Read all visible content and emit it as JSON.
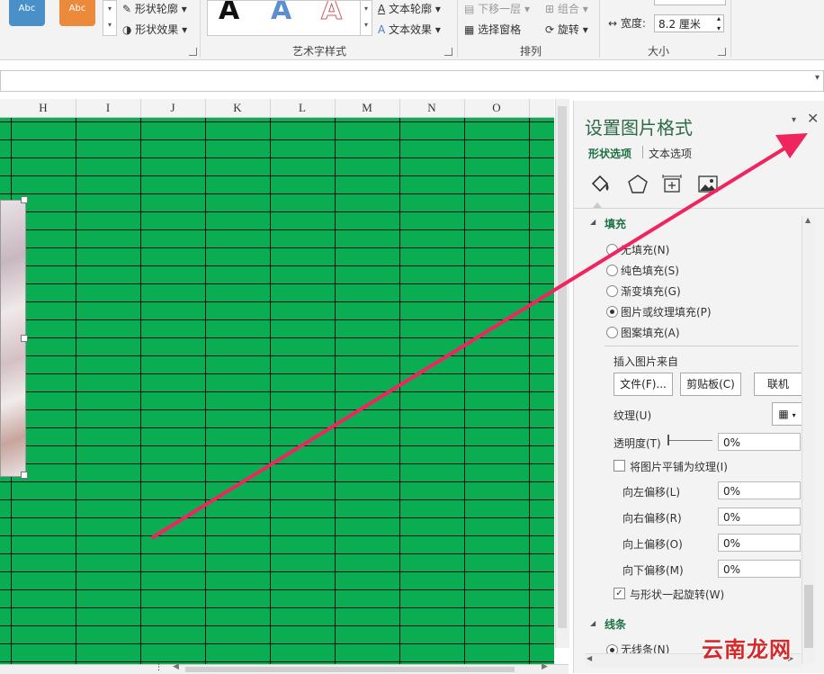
{
  "ribbon": {
    "style_thumb_1": "Abc",
    "style_thumb_2": "Abc",
    "shape_outline": "形状轮廓",
    "shape_effect": "形状效果",
    "wordart_letter": "A",
    "text_outline": "文本轮廓",
    "text_effect": "文本效果",
    "wordart_group_label": "艺术字样式",
    "send_backward": "下移一层",
    "group": "组合",
    "selection_pane": "选择窗格",
    "rotate": "旋转",
    "arrange_group_label": "排列",
    "width_label": "宽度:",
    "width_value": "8.2 厘米",
    "size_group_label": "大小"
  },
  "sheet": {
    "columns": [
      "H",
      "I",
      "J",
      "K",
      "L",
      "M",
      "N",
      "O"
    ]
  },
  "pane": {
    "title": "设置图片格式",
    "tab_shape": "形状选项",
    "tab_text": "文本选项",
    "fill_section": "填充",
    "fill_options": [
      {
        "label": "无填充(N)",
        "selected": false
      },
      {
        "label": "纯色填充(S)",
        "selected": false
      },
      {
        "label": "渐变填充(G)",
        "selected": false
      },
      {
        "label": "图片或纹理填充(P)",
        "selected": true
      },
      {
        "label": "图案填充(A)",
        "selected": false
      }
    ],
    "insert_from": "插入图片来自",
    "btn_file": "文件(F)...",
    "btn_clipboard": "剪贴板(C)",
    "btn_online": "联机(E)...",
    "texture_label": "纹理(U)",
    "transparency_label": "透明度(T)",
    "transparency_value": "0%",
    "tile_label": "将图片平铺为纹理(I)",
    "offset_left_label": "向左偏移(L)",
    "offset_left_value": "0%",
    "offset_right_label": "向右偏移(R)",
    "offset_right_value": "0%",
    "offset_up_label": "向上偏移(O)",
    "offset_up_value": "0%",
    "offset_down_label": "向下偏移(M)",
    "offset_down_value": "0%",
    "rotate_with_shape": "与形状一起旋转(W)",
    "line_section": "线条",
    "no_line": "无线条(N)"
  },
  "watermark": "云南龙网",
  "colors": {
    "sheet_fill": "#0aad52",
    "arrow": "#f0245e",
    "pane_accent": "#1e7145"
  }
}
